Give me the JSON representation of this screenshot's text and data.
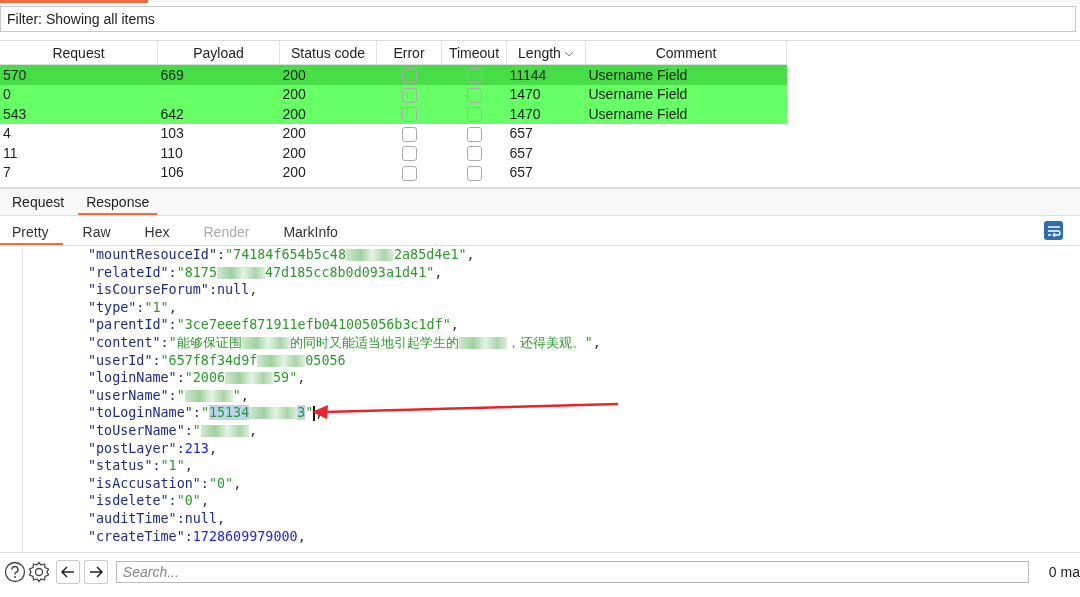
{
  "filter": {
    "value": "Filter: Showing all items"
  },
  "table": {
    "columns": [
      {
        "label": "Request",
        "sorted": false
      },
      {
        "label": "Payload",
        "sorted": false
      },
      {
        "label": "Status code",
        "sorted": false
      },
      {
        "label": "Error",
        "sorted": false
      },
      {
        "label": "Timeout",
        "sorted": false
      },
      {
        "label": "Length",
        "sorted": true
      },
      {
        "label": "Comment",
        "sorted": false
      }
    ],
    "rows": [
      {
        "request": "570",
        "payload": "669",
        "status": "200",
        "error": false,
        "timeout": false,
        "length": "11144",
        "comment": "Username Field",
        "color": "#46dd46"
      },
      {
        "request": "0",
        "payload": "",
        "status": "200",
        "error": false,
        "timeout": false,
        "length": "1470",
        "comment": "Username Field",
        "color": "#66ff66"
      },
      {
        "request": "543",
        "payload": "642",
        "status": "200",
        "error": false,
        "timeout": false,
        "length": "1470",
        "comment": "Username Field",
        "color": "#66ff66"
      },
      {
        "request": "4",
        "payload": "103",
        "status": "200",
        "error": false,
        "timeout": false,
        "length": "657",
        "comment": "",
        "color": "#ffffff"
      },
      {
        "request": "11",
        "payload": "110",
        "status": "200",
        "error": false,
        "timeout": false,
        "length": "657",
        "comment": "",
        "color": "#ffffff"
      },
      {
        "request": "7",
        "payload": "106",
        "status": "200",
        "error": false,
        "timeout": false,
        "length": "657",
        "comment": "",
        "color": "#ffffff"
      }
    ]
  },
  "tabs": [
    {
      "label": "Request",
      "selected": false
    },
    {
      "label": "Response",
      "selected": true
    }
  ],
  "view_tabs": [
    {
      "label": "Pretty",
      "selected": true,
      "disabled": false
    },
    {
      "label": "Raw",
      "selected": false,
      "disabled": false
    },
    {
      "label": "Hex",
      "selected": false,
      "disabled": false
    },
    {
      "label": "Render",
      "selected": false,
      "disabled": true
    },
    {
      "label": "MarkInfo",
      "selected": false,
      "disabled": false
    }
  ],
  "code_lines": [
    {
      "key": "\"mountResouceId\":",
      "value": [
        {
          "kind": "str",
          "text": "\"74184f654b5c48"
        },
        {
          "kind": "blur"
        },
        {
          "kind": "str",
          "text": "2a85d4e1\""
        }
      ],
      "comma": ","
    },
    {
      "key": "\"relateId\":",
      "value": [
        {
          "kind": "str",
          "text": "\"8175"
        },
        {
          "kind": "blur"
        },
        {
          "kind": "str",
          "text": "47d185cc8b0d093a1d41\""
        }
      ],
      "comma": ","
    },
    {
      "key": "\"isCourseForum\":",
      "value": [
        {
          "kind": "null",
          "text": "null"
        }
      ],
      "comma": ","
    },
    {
      "key": "\"type\":",
      "value": [
        {
          "kind": "str",
          "text": "\"1\""
        }
      ],
      "comma": ","
    },
    {
      "key": "\"parentId\":",
      "value": [
        {
          "kind": "str",
          "text": "\"3ce7eeef871911efb041005056b3c1df\""
        }
      ],
      "comma": ","
    },
    {
      "key": "\"content\":",
      "value": [
        {
          "kind": "str",
          "text": "\"能够保证围"
        },
        {
          "kind": "blur"
        },
        {
          "kind": "str",
          "text": "的同时又能适当地引起学生的"
        },
        {
          "kind": "blur"
        },
        {
          "kind": "str",
          "text": "，还得美观。\""
        }
      ],
      "comma": ","
    },
    {
      "key": "\"userId\":",
      "value": [
        {
          "kind": "str",
          "text": "\"657f8f34d9f"
        },
        {
          "kind": "blur"
        },
        {
          "kind": "str",
          "text": "05056"
        }
      ]
    },
    {
      "key": "\"loginName\":",
      "value": [
        {
          "kind": "str",
          "text": "\"2006"
        },
        {
          "kind": "blur"
        },
        {
          "kind": "str",
          "text": "59\""
        }
      ],
      "comma": ","
    },
    {
      "key": "\"userName\":",
      "value": [
        {
          "kind": "str",
          "text": "\""
        },
        {
          "kind": "blur"
        },
        {
          "kind": "str",
          "text": "\""
        }
      ],
      "comma": ","
    },
    {
      "key": "\"toLoginName\":",
      "value": [
        {
          "kind": "str",
          "text": "\""
        },
        {
          "kind": "sel",
          "text": "15134"
        },
        {
          "kind": "blur"
        },
        {
          "kind": "sel",
          "text": "3"
        },
        {
          "kind": "str",
          "text": "\""
        }
      ],
      "comma": ",",
      "caret": true
    },
    {
      "key": "\"toUserName\":",
      "value": [
        {
          "kind": "str",
          "text": "\""
        },
        {
          "kind": "blur"
        }
      ],
      "comma": ","
    },
    {
      "key": "\"postLayer\":",
      "value": [
        {
          "kind": "num",
          "text": "213"
        }
      ],
      "comma": ","
    },
    {
      "key": "\"status\":",
      "value": [
        {
          "kind": "str",
          "text": "\"1\""
        }
      ],
      "comma": ","
    },
    {
      "key": "\"isAccusation\":",
      "value": [
        {
          "kind": "str",
          "text": "\"0\""
        }
      ],
      "comma": ","
    },
    {
      "key": "\"isdelete\":",
      "value": [
        {
          "kind": "str",
          "text": "\"0\""
        }
      ],
      "comma": ","
    },
    {
      "key": "\"auditTime\":",
      "value": [
        {
          "kind": "null",
          "text": "null"
        }
      ],
      "comma": ","
    },
    {
      "key": "\"createTime\":",
      "value": [
        {
          "kind": "num",
          "text": "1728609979000"
        }
      ],
      "comma": ","
    }
  ],
  "search": {
    "placeholder": "Search..."
  },
  "match_count": "0 ma"
}
